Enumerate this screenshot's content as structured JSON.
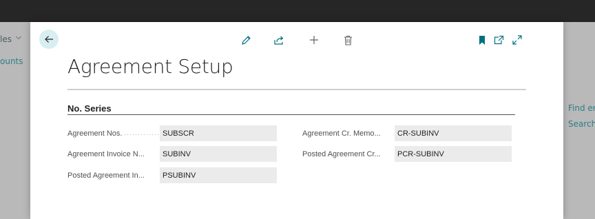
{
  "background": {
    "left_items": [
      "les",
      "ounts"
    ],
    "right_items": [
      "Find er",
      "Search"
    ]
  },
  "toolbar": {
    "back": "back-arrow-icon",
    "actions": [
      "edit-pencil-icon",
      "share-icon",
      "add-icon",
      "delete-trash-icon"
    ],
    "right_actions": [
      "bookmark-icon",
      "open-new-window-icon",
      "expand-icon"
    ]
  },
  "page": {
    "title": "Agreement Setup"
  },
  "section": {
    "title": "No. Series"
  },
  "fields": {
    "agreement_nos": {
      "label": "Agreement Nos.",
      "value": "SUBSCR"
    },
    "agreement_invoice_nos": {
      "label": "Agreement Invoice N...",
      "value": "SUBINV"
    },
    "posted_agreement_invoice_nos": {
      "label": "Posted Agreement In...",
      "value": "PSUBINV"
    },
    "agreement_cr_memo_nos": {
      "label": "Agreement Cr. Memo...",
      "value": "CR-SUBINV"
    },
    "posted_agreement_cr_memo_nos": {
      "label": "Posted Agreement Cr...",
      "value": "PCR-SUBINV"
    }
  },
  "colors": {
    "accent": "#00707f",
    "link": "#2e7d87",
    "input_bg": "#ebebeb",
    "topbar": "#262626"
  }
}
